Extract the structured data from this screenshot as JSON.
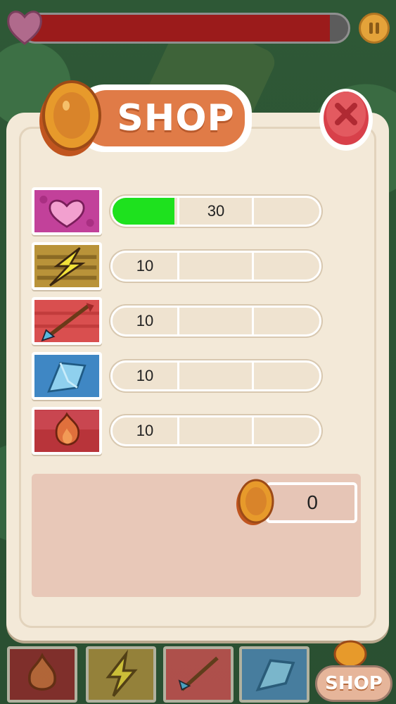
{
  "hud": {
    "health_fraction": 0.945
  },
  "shop": {
    "title": "SHOP",
    "items": [
      {
        "icon": "heart-icon",
        "label": "30",
        "fill_fraction": 0.3,
        "label_segment": 2
      },
      {
        "icon": "lightning-icon",
        "label": "10",
        "fill_fraction": 0,
        "label_segment": 1
      },
      {
        "icon": "arrow-icon",
        "label": "10",
        "fill_fraction": 0,
        "label_segment": 1
      },
      {
        "icon": "ice-icon",
        "label": "10",
        "fill_fraction": 0,
        "label_segment": 1
      },
      {
        "icon": "fire-icon",
        "label": "10",
        "fill_fraction": 0,
        "label_segment": 1
      }
    ],
    "coins": "0"
  },
  "toolbar": {
    "tools": [
      "fire-icon",
      "lightning-icon",
      "arrow-icon",
      "ice-icon"
    ],
    "shop_label": "SHOP"
  },
  "colors": {
    "health": "#9b1b1b",
    "upgrade_fill": "#1ee11e",
    "title_plate": "#e07b47",
    "panel": "#f3e9d8"
  }
}
